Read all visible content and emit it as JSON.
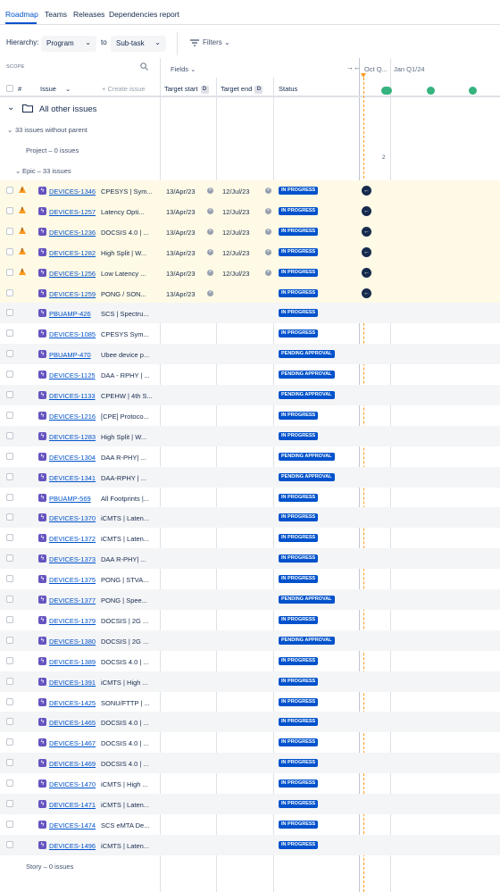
{
  "tabs": [
    {
      "label": "Roadmap",
      "active": true
    },
    {
      "label": "Teams"
    },
    {
      "label": "Releases"
    },
    {
      "label": "Dependencies report"
    }
  ],
  "toolbar": {
    "hierarchy_label": "Hierarchy:",
    "from_value": "Program",
    "to_label": "to",
    "to_value": "Sub-task",
    "filters_label": "Filters"
  },
  "grid": {
    "scope_label": "SCOPE",
    "fields_label": "Fields",
    "timeline_labels": [
      "Oct Q...",
      "Jan Q1/24"
    ],
    "milestone_count": "2",
    "headers": {
      "hash": "#",
      "issue": "Issue",
      "create_issue": "Create issue",
      "target_start": "Target start",
      "target_end": "Target end",
      "date_badge": "D",
      "status": "Status"
    }
  },
  "groups": {
    "all_other_issues": "All other issues",
    "without_parent": "33 issues without parent",
    "project": "Project – 0 issues",
    "epic": "Epic – 33 issues",
    "story": "Story – 0 issues"
  },
  "issues": [
    {
      "key": "DEVICES-1346",
      "summary": "CPESYS | Sym...",
      "start": "13/Apr/23",
      "end": "12/Jul/23",
      "status": "IN PROGRESS",
      "warn": true
    },
    {
      "key": "DEVICES-1257",
      "summary": "Latency Opti...",
      "start": "13/Apr/23",
      "end": "12/Jul/23",
      "status": "IN PROGRESS",
      "warn": true
    },
    {
      "key": "DEVICES-1236",
      "summary": "DOCSIS 4.0 | ...",
      "start": "13/Apr/23",
      "end": "12/Jul/23",
      "status": "IN PROGRESS",
      "warn": true
    },
    {
      "key": "DEVICES-1282",
      "summary": "High Split | W...",
      "start": "13/Apr/23",
      "end": "12/Jul/23",
      "status": "IN PROGRESS",
      "warn": true
    },
    {
      "key": "DEVICES-1256",
      "summary": "Low Latency ...",
      "start": "13/Apr/23",
      "end": "12/Jul/23",
      "status": "IN PROGRESS",
      "warn": true
    },
    {
      "key": "DEVICES-1259",
      "summary": "PONG / SON...",
      "start": "13/Apr/23",
      "end": "",
      "status": "IN PROGRESS",
      "warn": false
    },
    {
      "key": "PBUAMP-426",
      "summary": "SCS | Spectru...",
      "start": "",
      "end": "",
      "status": "IN PROGRESS",
      "warn": false
    },
    {
      "key": "DEVICES-1085",
      "summary": "CPESYS Sym...",
      "start": "",
      "end": "",
      "status": "IN PROGRESS",
      "warn": false
    },
    {
      "key": "PBUAMP-470",
      "summary": "Ubee device p...",
      "start": "",
      "end": "",
      "status": "PENDING APPROVAL",
      "warn": false
    },
    {
      "key": "DEVICES-1125",
      "summary": "DAA - RPHY | ...",
      "start": "",
      "end": "",
      "status": "PENDING APPROVAL",
      "warn": false
    },
    {
      "key": "DEVICES-1133",
      "summary": "CPEHW | 4th S...",
      "start": "",
      "end": "",
      "status": "PENDING APPROVAL",
      "warn": false
    },
    {
      "key": "DEVICES-1216",
      "summary": "[CPE] Protoco...",
      "start": "",
      "end": "",
      "status": "IN PROGRESS",
      "warn": false
    },
    {
      "key": "DEVICES-1283",
      "summary": "High Split | W...",
      "start": "",
      "end": "",
      "status": "IN PROGRESS",
      "warn": false
    },
    {
      "key": "DEVICES-1304",
      "summary": "DAA R-PHY| ...",
      "start": "",
      "end": "",
      "status": "PENDING APPROVAL",
      "warn": false
    },
    {
      "key": "DEVICES-1341",
      "summary": "DAA-RPHY | ...",
      "start": "",
      "end": "",
      "status": "PENDING APPROVAL",
      "warn": false
    },
    {
      "key": "PBUAMP-569",
      "summary": "All Footprints |...",
      "start": "",
      "end": "",
      "status": "IN PROGRESS",
      "warn": false
    },
    {
      "key": "DEVICES-1370",
      "summary": "iCMTS | Laten...",
      "start": "",
      "end": "",
      "status": "IN PROGRESS",
      "warn": false
    },
    {
      "key": "DEVICES-1372",
      "summary": "iCMTS | Laten...",
      "start": "",
      "end": "",
      "status": "IN PROGRESS",
      "warn": false
    },
    {
      "key": "DEVICES-1373",
      "summary": "DAA R-PHY| ...",
      "start": "",
      "end": "",
      "status": "IN PROGRESS",
      "warn": false
    },
    {
      "key": "DEVICES-1375",
      "summary": "PONG | STVA...",
      "start": "",
      "end": "",
      "status": "IN PROGRESS",
      "warn": false
    },
    {
      "key": "DEVICES-1377",
      "summary": "PONG | Spee...",
      "start": "",
      "end": "",
      "status": "PENDING APPROVAL",
      "warn": false
    },
    {
      "key": "DEVICES-1379",
      "summary": "DOCSIS | 2G ...",
      "start": "",
      "end": "",
      "status": "IN PROGRESS",
      "warn": false
    },
    {
      "key": "DEVICES-1380",
      "summary": "DOCSIS | 2G ...",
      "start": "",
      "end": "",
      "status": "PENDING APPROVAL",
      "warn": false
    },
    {
      "key": "DEVICES-1389",
      "summary": "DOCSIS 4.0 | ...",
      "start": "",
      "end": "",
      "status": "IN PROGRESS",
      "warn": false
    },
    {
      "key": "DEVICES-1391",
      "summary": "iCMTS | High ...",
      "start": "",
      "end": "",
      "status": "IN PROGRESS",
      "warn": false
    },
    {
      "key": "DEVICES-1425",
      "summary": "SONU/FTTP | ...",
      "start": "",
      "end": "",
      "status": "IN PROGRESS",
      "warn": false
    },
    {
      "key": "DEVICES-1465",
      "summary": "DOCSIS 4.0 | ...",
      "start": "",
      "end": "",
      "status": "IN PROGRESS",
      "warn": false
    },
    {
      "key": "DEVICES-1467",
      "summary": "DOCSIS 4.0 | ...",
      "start": "",
      "end": "",
      "status": "IN PROGRESS",
      "warn": false
    },
    {
      "key": "DEVICES-1469",
      "summary": "DOCSIS 4.0 | ...",
      "start": "",
      "end": "",
      "status": "IN PROGRESS",
      "warn": false
    },
    {
      "key": "DEVICES-1470",
      "summary": "iCMTS | High ...",
      "start": "",
      "end": "",
      "status": "IN PROGRESS",
      "warn": false
    },
    {
      "key": "DEVICES-1471",
      "summary": "iCMTS | Laten...",
      "start": "",
      "end": "",
      "status": "IN PROGRESS",
      "warn": false
    },
    {
      "key": "DEVICES-1474",
      "summary": "SCS eMTA De...",
      "start": "",
      "end": "",
      "status": "IN PROGRESS",
      "warn": false
    },
    {
      "key": "DEVICES-1496",
      "summary": "iCMTS | Laten...",
      "start": "",
      "end": "",
      "status": "IN PROGRESS",
      "warn": false
    }
  ],
  "colors": {
    "accent": "#0052cc",
    "in_progress": "#0052cc",
    "pending": "#0052cc",
    "warning": "#ff991f",
    "milestone": "#36b37e",
    "epic": "#6554c0",
    "highlight_row": "#fffae6"
  },
  "icons": {
    "warning": "warning-icon",
    "epic": "epic-icon",
    "arrow": "arrow-left-icon",
    "folder": "folder-icon",
    "search": "search-icon",
    "filter": "filter-icon"
  }
}
